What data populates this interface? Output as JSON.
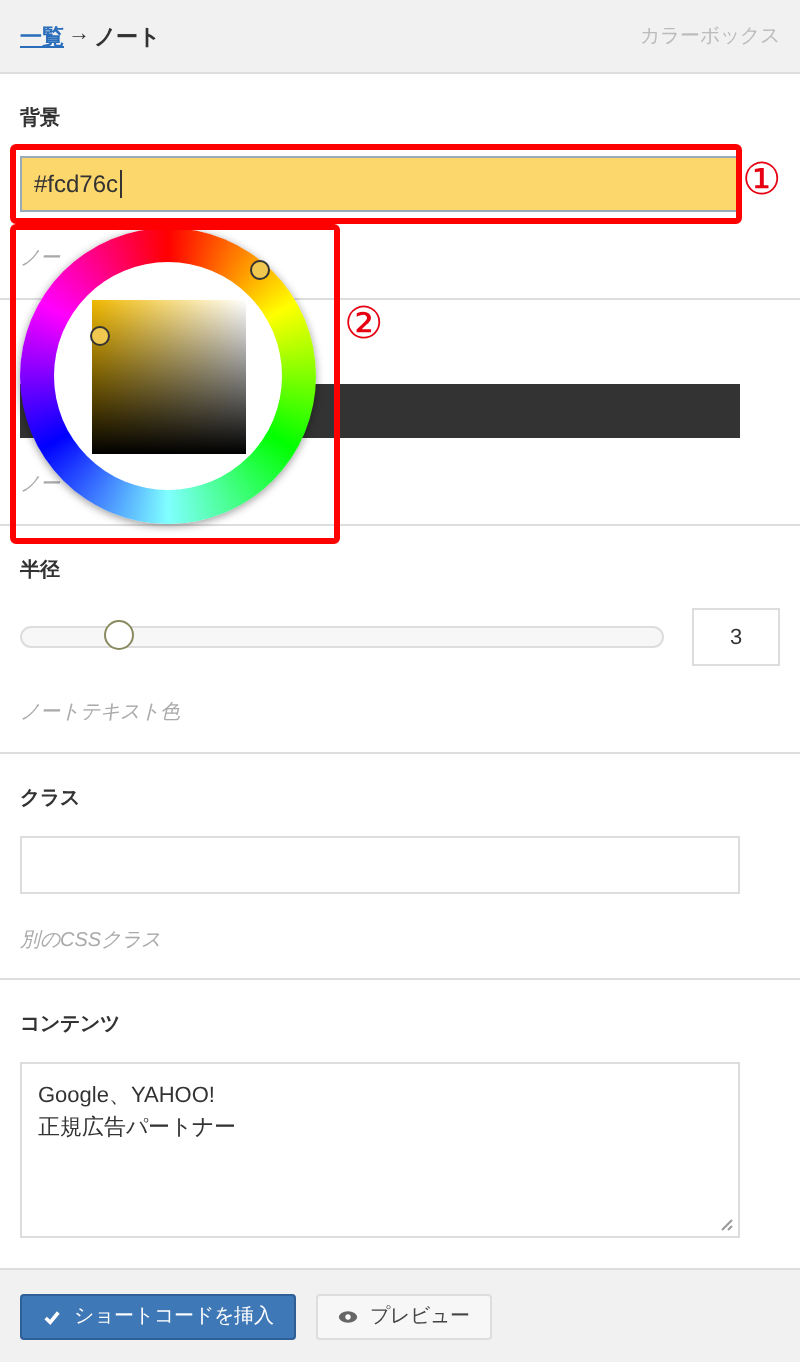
{
  "breadcrumb": {
    "link": "一覧",
    "arrow": "→",
    "current": "ノート"
  },
  "header_title": "カラーボックス",
  "sections": [
    {
      "kind": "color",
      "label": "背景",
      "value": "#fcd76c",
      "hint": "ノー"
    },
    {
      "kind": "colorbar",
      "color": "#333333",
      "hint": "ノー"
    },
    {
      "kind": "slider",
      "label": "半径",
      "level": 0.15,
      "value": "3",
      "hint": "ノートテキスト色"
    },
    {
      "kind": "text",
      "label": "クラス",
      "hint": "別のCSSクラス"
    },
    {
      "kind": "textarea",
      "label": "コンテンツ",
      "value": "Google、YAHOO!\n正規広告パートナー"
    }
  ],
  "buttons": [
    {
      "label": "ショートコードを挿入",
      "kind": "primary"
    },
    {
      "label": "プレビュー",
      "kind": "secondary"
    }
  ],
  "annotations": [
    {
      "number": "①"
    },
    {
      "number": "②"
    }
  ]
}
